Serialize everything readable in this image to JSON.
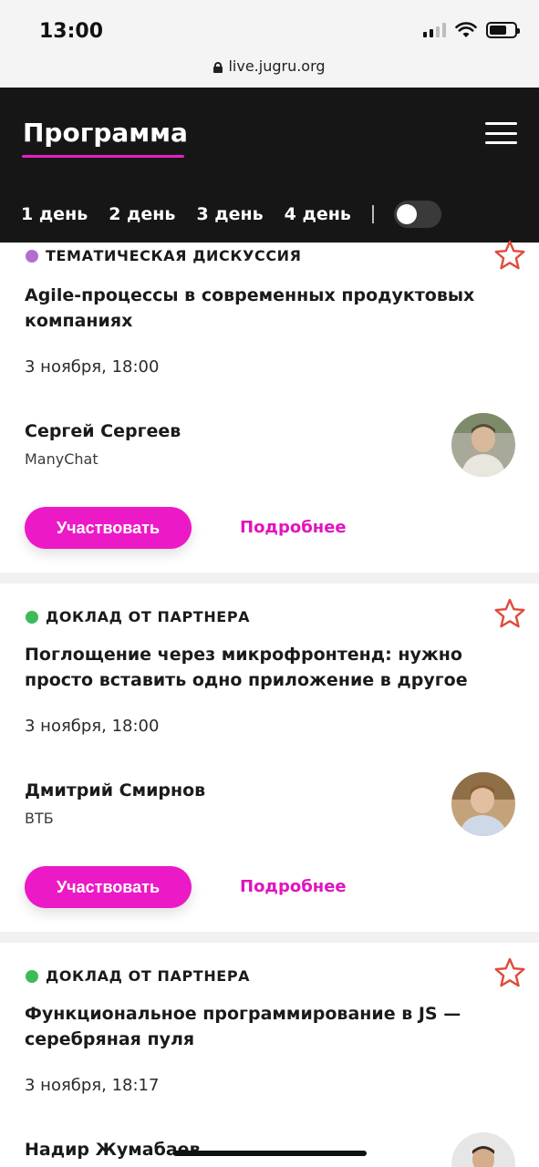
{
  "status_bar": {
    "time": "13:00"
  },
  "browser": {
    "url": "live.jugru.org"
  },
  "header": {
    "title": "Программа",
    "days": [
      "1 день",
      "2 день",
      "3 день",
      "4 день"
    ]
  },
  "colors": {
    "accent": "#ec1ac6",
    "discussion_dot": "#b06fd0",
    "partner_dot": "#3dbb5a",
    "star": "#e04a3a"
  },
  "talks": [
    {
      "tag": "ТЕМАТИЧЕСКАЯ ДИСКУССИЯ",
      "title": "Agile-процессы в современных продуктовых компаниях",
      "date": "3 ноября, 18:00",
      "speaker": "Сергей Сергеев",
      "company": "ManyChat",
      "join_label": "Участвовать",
      "more_label": "Подробнее"
    },
    {
      "tag": "ДОКЛАД ОТ ПАРТНЕРА",
      "title": "Поглощение через микрофронтенд: нужно просто вставить одно приложение в другое",
      "date": "3 ноября, 18:00",
      "speaker": "Дмитрий Смирнов",
      "company": "ВТБ",
      "join_label": "Участвовать",
      "more_label": "Подробнее"
    },
    {
      "tag": "ДОКЛАД ОТ ПАРТНЕРА",
      "title": "Функциональное программирование в JS — серебряная пуля",
      "date": "3 ноября, 18:17",
      "speaker": "Надир Жумабаев"
    }
  ]
}
